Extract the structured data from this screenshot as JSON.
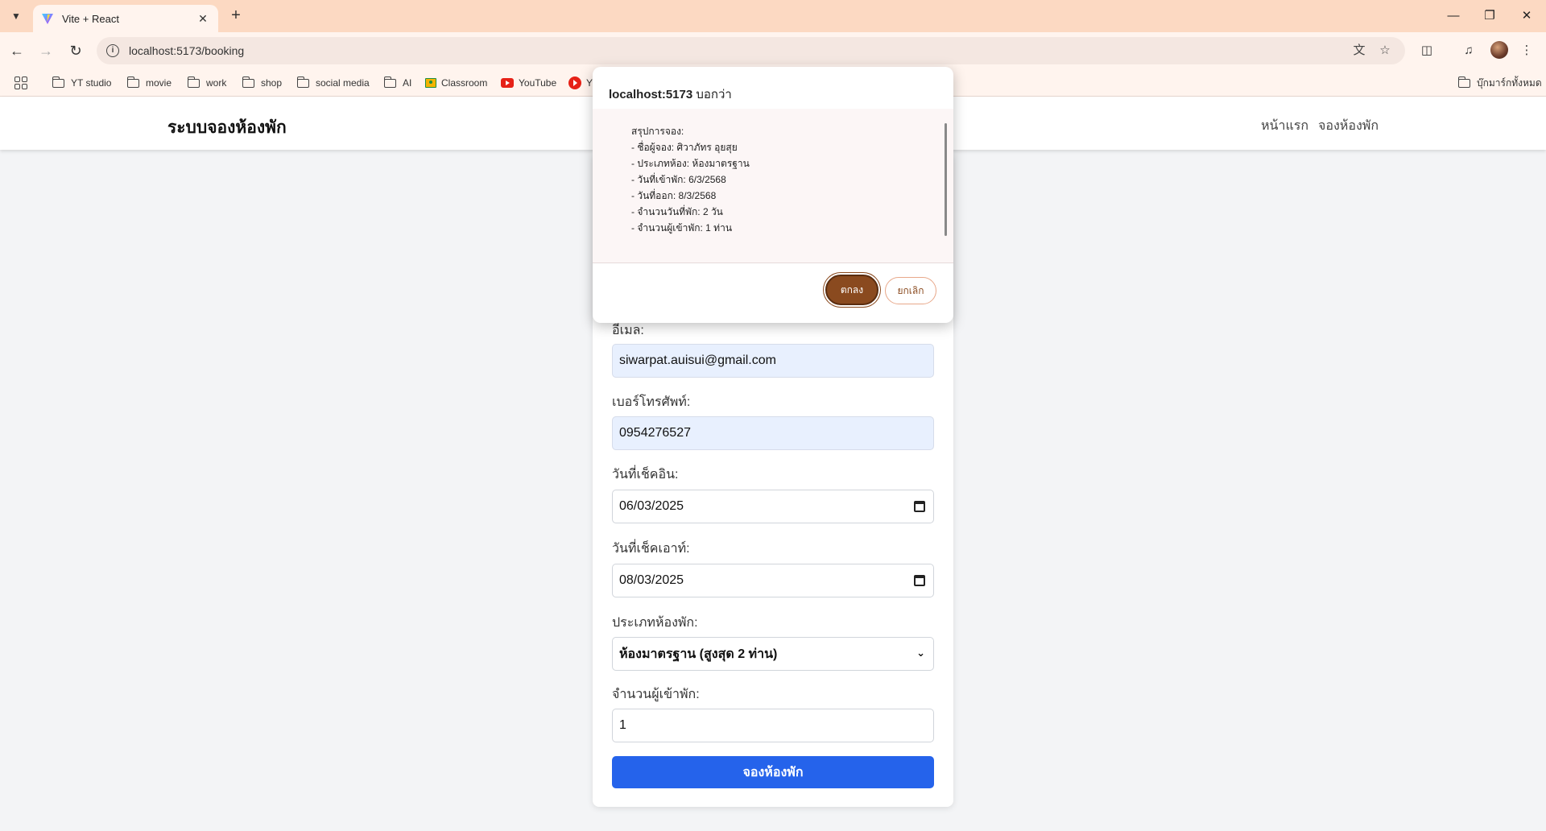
{
  "browser": {
    "tab_title": "Vite + React",
    "url": "localhost:5173/booking",
    "bookmarks": [
      "YT studio",
      "movie",
      "work",
      "shop",
      "social media",
      "AI",
      "Classroom",
      "YouTube",
      "Y"
    ],
    "all_bookmarks": "บุ๊กมาร์กทั้งหมด"
  },
  "site": {
    "brand": "ระบบจองห้องพัก",
    "nav": [
      "หน้าแรก",
      "จองห้องพัก"
    ]
  },
  "form": {
    "email_label": "อีเมล:",
    "email_value": "siwarpat.auisui@gmail.com",
    "phone_label": "เบอร์โทรศัพท์:",
    "phone_value": "0954276527",
    "checkin_label": "วันที่เช็คอิน:",
    "checkin_value": "06/03/2025",
    "checkout_label": "วันที่เช็คเอาท์:",
    "checkout_value": "08/03/2025",
    "room_label": "ประเภทห้องพัก:",
    "room_value": "ห้องมาตรฐาน (สูงสุด 2 ท่าน)",
    "guests_label": "จำนวนผู้เข้าพัก:",
    "guests_value": "1",
    "submit_label": "จองห้องพัก"
  },
  "dialog": {
    "origin": "localhost:5173",
    "says": "บอกว่า",
    "message": "สรุปการจอง:\n- ชื่อผู้จอง: ศิวาภัทร อุยสุย\n- ประเภทห้อง: ห้องมาตรฐาน\n- วันที่เข้าพัก: 6/3/2568\n- วันที่ออก: 8/3/2568\n- จำนวนวันที่พัก: 2 วัน\n- จำนวนผู้เข้าพัก: 1 ท่าน",
    "ok_label": "ตกลง",
    "cancel_label": "ยกเลิก"
  },
  "colors": {
    "tabbar": "#fcd9c2",
    "primary_button": "#2563eb",
    "dialog_ok": "#8a4a1f"
  }
}
